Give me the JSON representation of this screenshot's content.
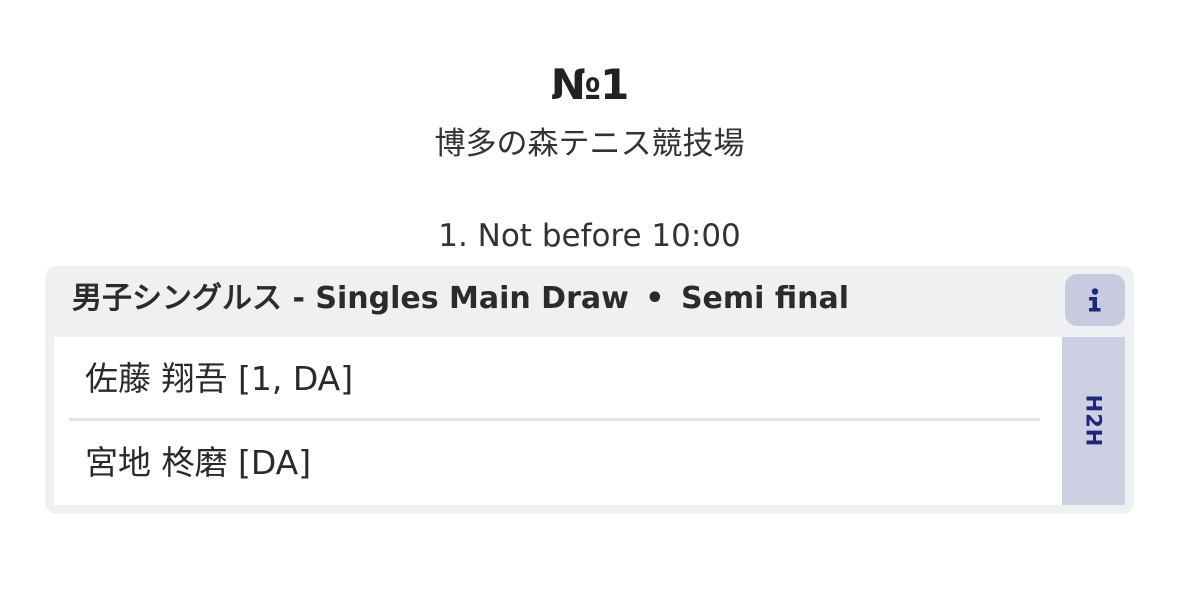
{
  "court": {
    "name": "№1",
    "venue": "博多の森テニス競技場"
  },
  "schedule": {
    "time_label": "1. Not before 10:00"
  },
  "match": {
    "event": "男子シングルス",
    "draw": "- Singles Main Draw",
    "separator": "•",
    "round": "Semi final",
    "info_icon": "info-icon",
    "players": [
      {
        "name": "佐藤 翔吾 [1, DA]"
      },
      {
        "name": "宮地 柊磨 [DA]"
      }
    ],
    "h2h_label": "H2H"
  },
  "colors": {
    "card_background": "#eff0f2",
    "info_button": "#c8cbdf",
    "h2h_button": "#cdd0e3",
    "accent_navy": "#1f2778"
  }
}
